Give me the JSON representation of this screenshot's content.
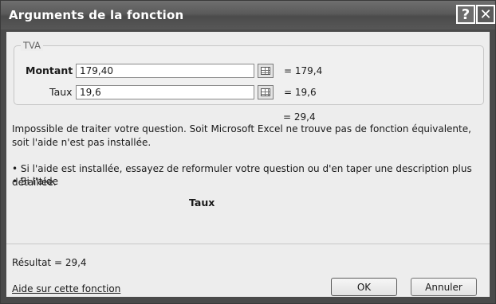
{
  "window": {
    "title": "Arguments de la fonction",
    "help_glyph": "?",
    "close_glyph": "✕"
  },
  "group": {
    "label": "TVA",
    "args": [
      {
        "label": "Montant",
        "value": "179,40",
        "result": "=  179,4"
      },
      {
        "label": "Taux",
        "value": "19,6",
        "result": "=  19,6"
      }
    ],
    "total": "=  29,4"
  },
  "description": {
    "line1": "Impossible de traiter votre question. Soit Microsoft Excel ne trouve pas de fonction équivalente, soit l'aide n'est pas installée.",
    "line2": "• Si l'aide est installée, essayez de reformuler votre question ou d'en taper une description plus détaillée.",
    "line3": "• Si l'aide",
    "param_name": "Taux"
  },
  "footer": {
    "result": "Résultat =   29,4",
    "help_link": "Aide sur cette fonction",
    "ok": "OK",
    "cancel": "Annuler"
  }
}
